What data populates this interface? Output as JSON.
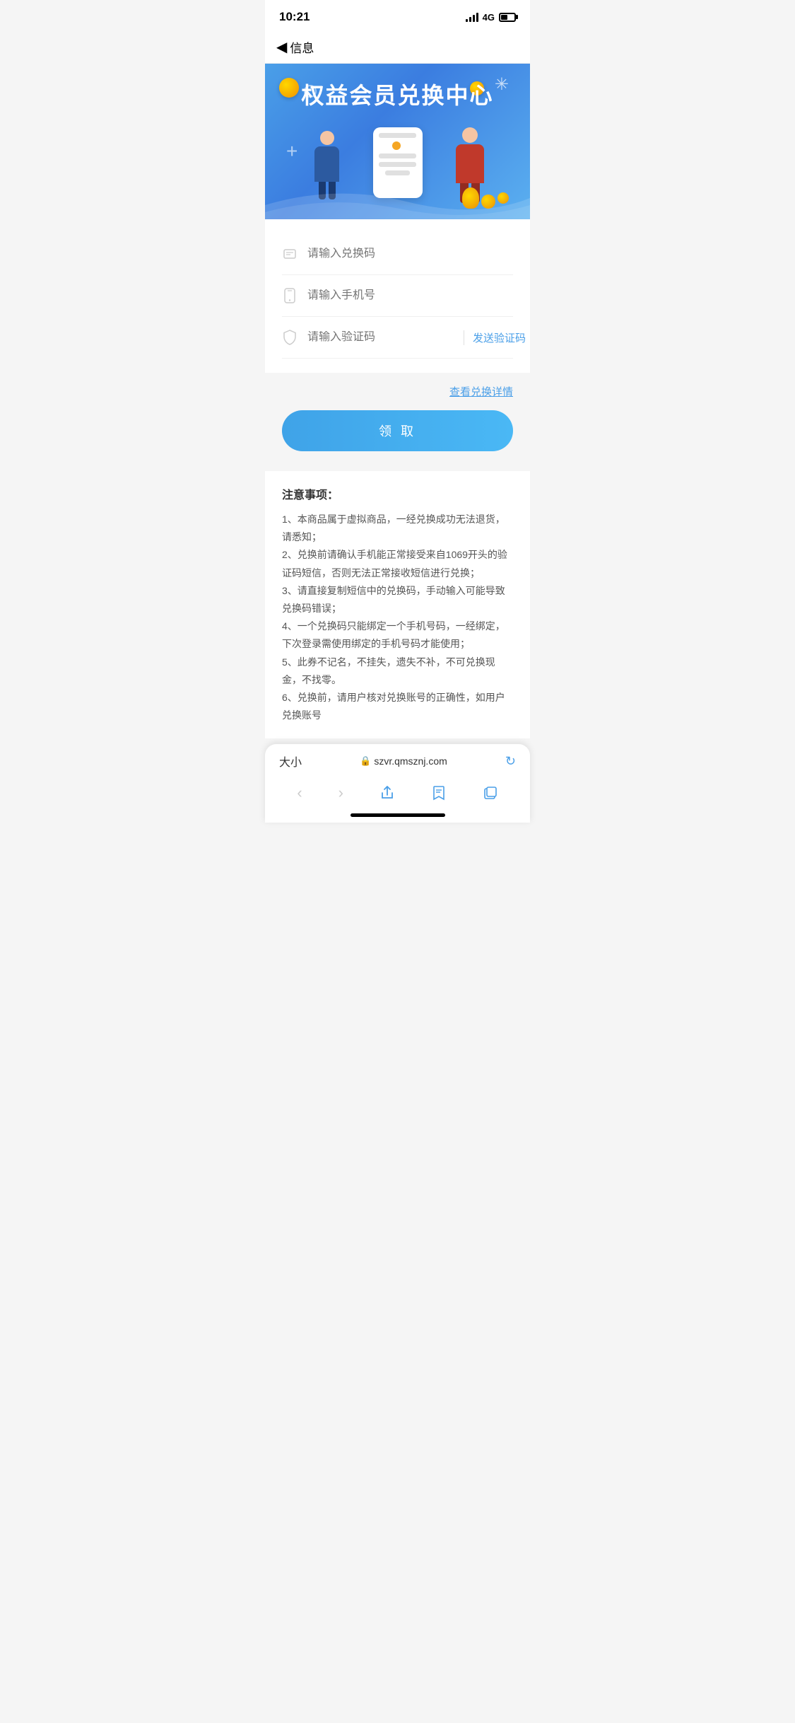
{
  "statusBar": {
    "time": "10:21",
    "network": "4G"
  },
  "navBar": {
    "backLabel": "信息"
  },
  "hero": {
    "title": "权益会员兑换中心"
  },
  "form": {
    "exchangeCodePlaceholder": "请输入兑换码",
    "phonePlaceholder": "请输入手机号",
    "verifyCodePlaceholder": "请输入验证码",
    "sendCodeLabel": "发送验证码"
  },
  "actions": {
    "viewDetailLabel": "查看兑换详情",
    "submitLabel": "领 取"
  },
  "notice": {
    "title": "注意事项：",
    "items": [
      "1、本商品属于虚拟商品，一经兑换成功无法退货，请悉知；",
      "2、兑换前请确认手机能正常接受来自1069开头的验证码短信，否则无法正常接收短信进行兑换；",
      "3、请直接复制短信中的兑换码，手动输入可能导致兑换码错误；",
      "4、一个兑换码只能绑定一个手机号码，一经绑定，下次登录需使用绑定的手机号码才能使用；",
      "5、此券不记名，不挂失，遗失不补，不可兑换现金，不找零。",
      "6、兑换前，请用户核对兑换账号的正确性，如用户兑换账号"
    ]
  },
  "browser": {
    "fontSizeLabel": "大小",
    "url": "szvr.qmsznj.com"
  }
}
